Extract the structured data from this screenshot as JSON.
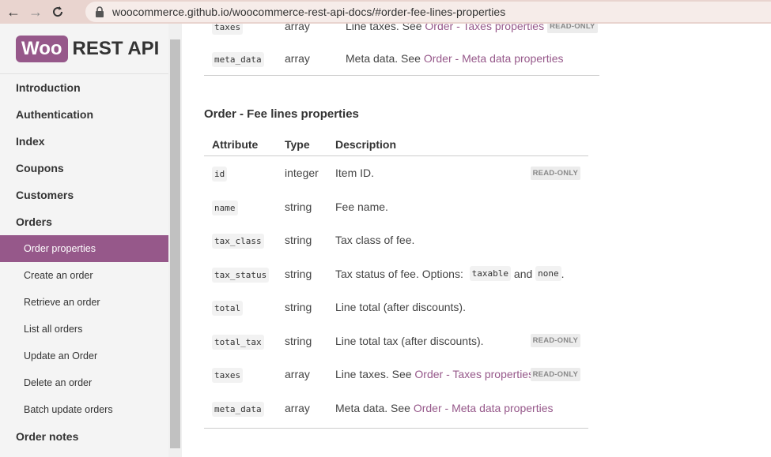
{
  "browser": {
    "url": "woocommerce.github.io/woocommerce-rest-api-docs/#order-fee-lines-properties"
  },
  "logo": {
    "badge": "Woo",
    "text": "REST API"
  },
  "sidebar": {
    "items": [
      {
        "label": "Introduction"
      },
      {
        "label": "Authentication"
      },
      {
        "label": "Index"
      },
      {
        "label": "Coupons"
      },
      {
        "label": "Customers"
      },
      {
        "label": "Orders"
      },
      {
        "label": "Order properties"
      },
      {
        "label": "Create an order"
      },
      {
        "label": "Retrieve an order"
      },
      {
        "label": "List all orders"
      },
      {
        "label": "Update an Order"
      },
      {
        "label": "Delete an order"
      },
      {
        "label": "Batch update orders"
      },
      {
        "label": "Order notes"
      }
    ]
  },
  "prev_table": {
    "rows": [
      {
        "attr": "taxes",
        "type": "array",
        "desc": "Line taxes. See ",
        "link": "Order - Taxes properties",
        "badge": "READ-ONLY"
      },
      {
        "attr": "meta_data",
        "type": "array",
        "desc": "Meta data. See ",
        "link": "Order - Meta data properties"
      }
    ]
  },
  "section": {
    "title": "Order - Fee lines properties",
    "headers": {
      "attr": "Attribute",
      "type": "Type",
      "desc": "Description"
    },
    "rows": [
      {
        "attr": "id",
        "type": "integer",
        "desc": "Item ID.",
        "badge": "READ-ONLY"
      },
      {
        "attr": "name",
        "type": "string",
        "desc": "Fee name."
      },
      {
        "attr": "tax_class",
        "type": "string",
        "desc": "Tax class of fee."
      },
      {
        "attr": "tax_status",
        "type": "string",
        "desc": "Tax status of fee. Options: ",
        "code1": "taxable",
        "and": "and",
        "code2": "none",
        "end": "."
      },
      {
        "attr": "total",
        "type": "string",
        "desc": "Line total (after discounts)."
      },
      {
        "attr": "total_tax",
        "type": "string",
        "desc": "Line total tax (after discounts).",
        "badge": "READ-ONLY"
      },
      {
        "attr": "taxes",
        "type": "array",
        "desc": "Line taxes. See ",
        "link": "Order - Taxes properties",
        "badge": "READ-ONLY"
      },
      {
        "attr": "meta_data",
        "type": "array",
        "desc": "Meta data. See ",
        "link": "Order - Meta data properties"
      }
    ]
  },
  "colors": {
    "accent": "#96588a",
    "browser_bar": "#e9d4cf"
  }
}
